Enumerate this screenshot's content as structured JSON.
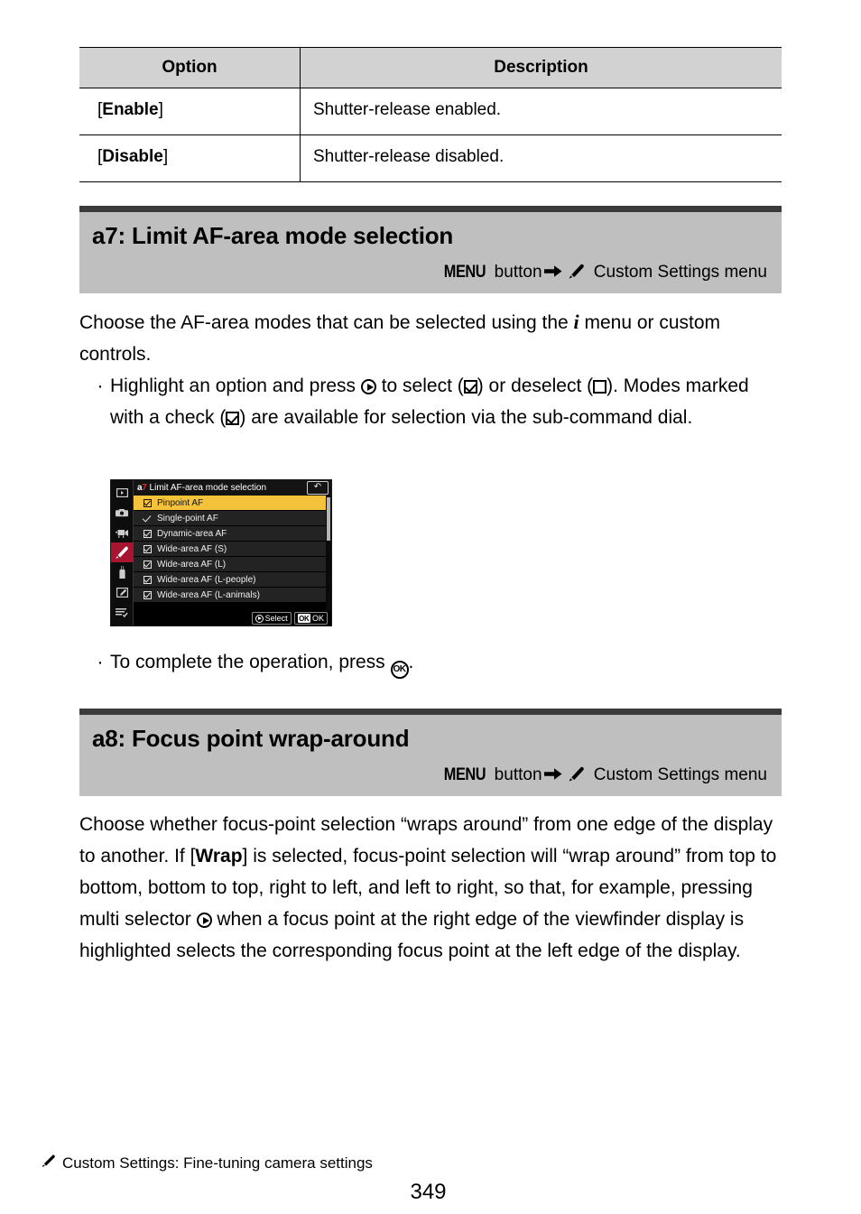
{
  "options_table": {
    "headers": [
      "Option",
      "Description"
    ],
    "rows": [
      {
        "option_prefix": "[",
        "option": "Enable",
        "option_suffix": "]",
        "description": "Shutter-release enabled."
      },
      {
        "option_prefix": "[",
        "option": "Disable",
        "option_suffix": "]",
        "description": "Shutter-release disabled."
      }
    ]
  },
  "section_a7": {
    "title": "a7: Limit AF-area mode selection",
    "path": {
      "menu_label": "MENU",
      "button_word": " button",
      "arrow_icon": "arrow-right-icon",
      "pencil_icon": "pencil-icon",
      "destination": " Custom Settings menu"
    },
    "intro_part1": "Choose the AF-area modes that can be selected using the ",
    "intro_italic_i": "i",
    "intro_part2": " menu or custom controls.",
    "bullet1_a": "Highlight an option and press ",
    "bullet1_b": " to select (",
    "bullet1_c": ") or deselect (",
    "bullet1_d": "). Modes marked with a check (",
    "bullet1_e": ") are available for selection via the sub-command dial.",
    "bullet2_a": "To complete the operation, press ",
    "bullet2_ok": "OK",
    "bullet2_b": "."
  },
  "camera_menu": {
    "header_code_letter": "a",
    "header_code_number": "7",
    "header_title": "Limit AF-area mode selection",
    "back_icon": "return-arrow-icon",
    "sidebar_items": [
      {
        "name": "playback-menu-icon",
        "active": false
      },
      {
        "name": "photo-shooting-menu-icon",
        "active": false
      },
      {
        "name": "video-recording-menu-icon",
        "active": false
      },
      {
        "name": "custom-settings-menu-icon",
        "active": true
      },
      {
        "name": "setup-menu-icon",
        "active": false
      },
      {
        "name": "retouch-menu-icon",
        "active": false
      },
      {
        "name": "my-menu-icon",
        "active": false
      }
    ],
    "rows": [
      {
        "label": "Pinpoint AF",
        "mark": "checkbox",
        "selected": true
      },
      {
        "label": "Single-point AF",
        "mark": "tick",
        "selected": false
      },
      {
        "label": "Dynamic-area AF",
        "mark": "checkbox",
        "selected": false
      },
      {
        "label": "Wide-area AF (S)",
        "mark": "checkbox",
        "selected": false
      },
      {
        "label": "Wide-area AF (L)",
        "mark": "checkbox",
        "selected": false
      },
      {
        "label": "Wide-area AF (L-people)",
        "mark": "checkbox",
        "selected": false
      },
      {
        "label": "Wide-area AF (L-animals)",
        "mark": "checkbox",
        "selected": false
      }
    ],
    "footer_select_label": "Select",
    "footer_ok_badge": "OK",
    "footer_ok_label": "OK"
  },
  "section_a8": {
    "title": "a8: Focus point wrap-around",
    "path": {
      "menu_label": "MENU",
      "button_word": " button",
      "arrow_icon": "arrow-right-icon",
      "pencil_icon": "pencil-icon",
      "destination": " Custom Settings menu"
    },
    "body_a": "Choose whether focus-point selection “wraps around” from one edge of the display to another. If [",
    "body_bold": "Wrap",
    "body_b": "] is selected, focus-point selection will “wrap around” from top to bottom, bottom to top, right to left, and left to right, so that, for example, pressing multi selector ",
    "body_c": " when a focus point at the right edge of the viewfinder display is highlighted selects the corresponding focus point at the left edge of the display."
  },
  "footer": {
    "pencil_icon": "pencil-icon",
    "chapter": "Custom Settings: Fine-tuning camera settings",
    "page_number": "349"
  },
  "colors": {
    "band_gray": "#bfbfbf",
    "rule_dark": "#3b3b3b",
    "table_header_gray": "#d2d2d2",
    "menu_highlight_yellow": "#f5c33b",
    "menu_accent_red": "#a81530",
    "code_red": "#e8252a"
  }
}
